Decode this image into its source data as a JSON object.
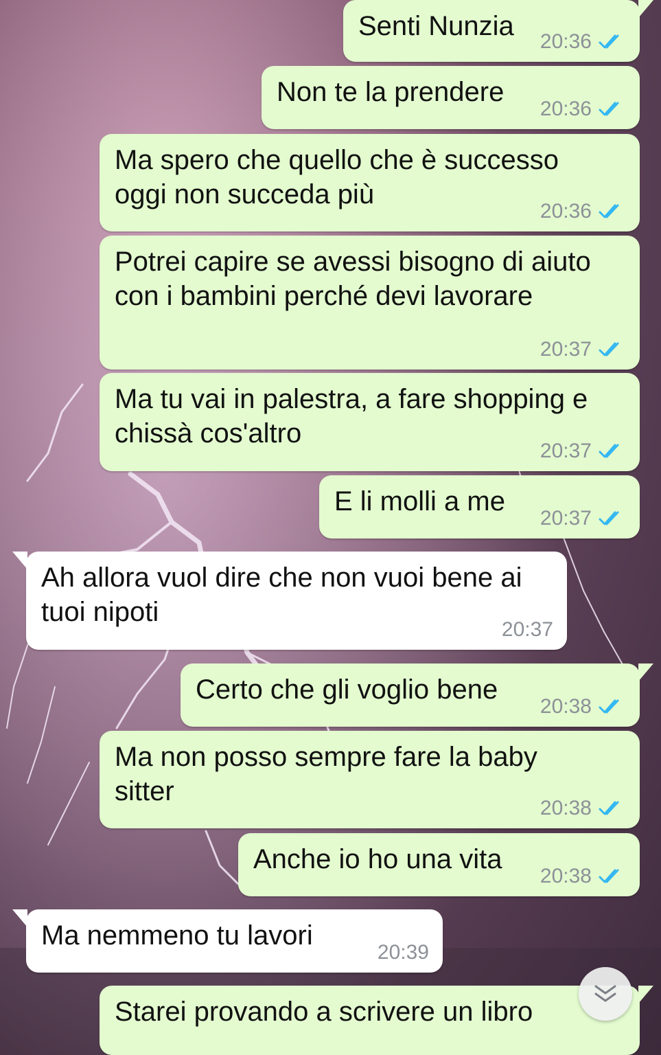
{
  "colors": {
    "outgoing_bubble": "#e3fbcf",
    "incoming_bubble": "#ffffff",
    "read_ticks": "#34b7f1",
    "time_text": "#8c9097"
  },
  "messages": [
    {
      "direction": "outgoing",
      "text": "Senti Nunzia",
      "time": "20:36",
      "status": "read"
    },
    {
      "direction": "outgoing",
      "text": "Non te la prendere",
      "time": "20:36",
      "status": "read"
    },
    {
      "direction": "outgoing",
      "text": "Ma spero che quello che è successo\noggi non succeda più",
      "time": "20:36",
      "status": "read"
    },
    {
      "direction": "outgoing",
      "text": "Potrei capire se avessi bisogno di aiuto\ncon i bambini perché devi lavorare",
      "time": "20:37",
      "status": "read"
    },
    {
      "direction": "outgoing",
      "text": "Ma tu vai in palestra, a fare shopping e\nchissà cos'altro",
      "time": "20:37",
      "status": "read"
    },
    {
      "direction": "outgoing",
      "text": "E li molli a me",
      "time": "20:37",
      "status": "read"
    },
    {
      "direction": "incoming",
      "text": "Ah allora vuol dire che non vuoi bene ai\ntuoi nipoti",
      "time": "20:37"
    },
    {
      "direction": "outgoing",
      "text": "Certo che gli voglio bene",
      "time": "20:38",
      "status": "read"
    },
    {
      "direction": "outgoing",
      "text": "Ma non posso sempre fare la baby\nsitter",
      "time": "20:38",
      "status": "read"
    },
    {
      "direction": "outgoing",
      "text": "Anche io ho una vita",
      "time": "20:38",
      "status": "read"
    },
    {
      "direction": "incoming",
      "text": "Ma nemmeno tu lavori",
      "time": "20:39"
    },
    {
      "direction": "outgoing",
      "text": "Starei provando a scrivere un libro",
      "time": "",
      "status": ""
    }
  ],
  "scroll_button": {
    "icon": "double-chevron-down-icon"
  }
}
